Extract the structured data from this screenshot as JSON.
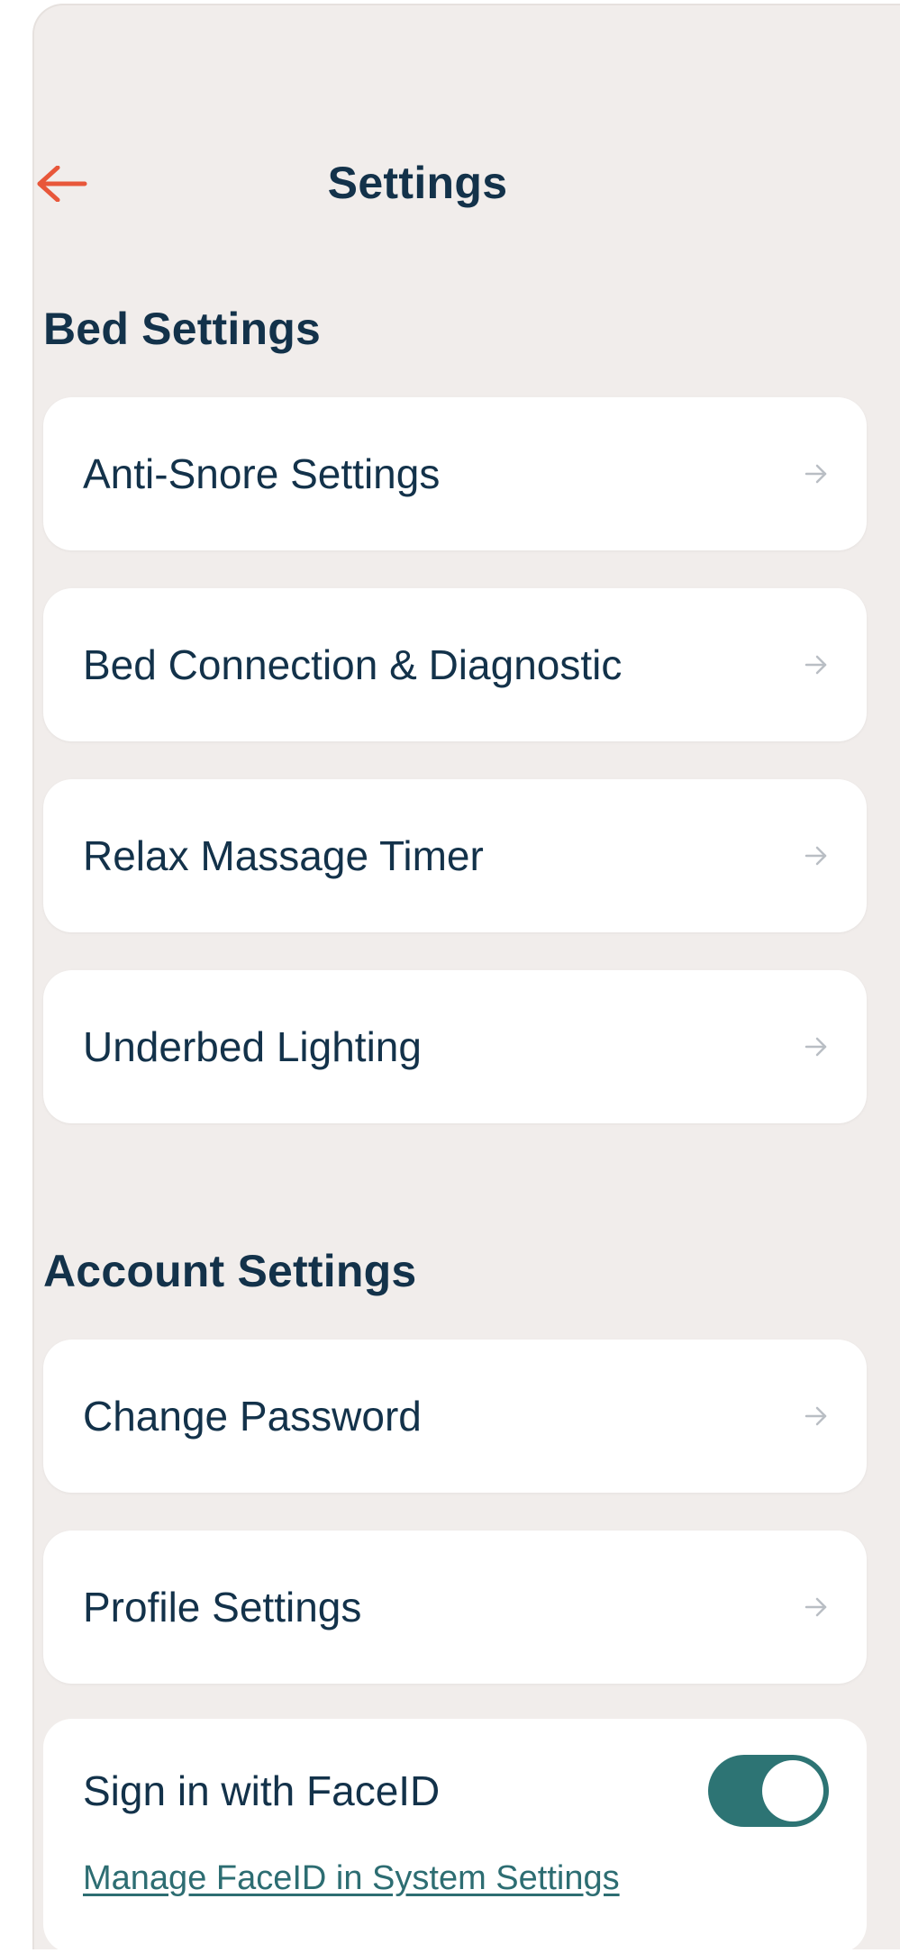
{
  "header": {
    "title": "Settings",
    "back_icon": "arrow-left-icon"
  },
  "colors": {
    "accent": "#e8573a",
    "text": "#13324a",
    "toggle_on": "#2d7474",
    "link": "#2d6d72",
    "background": "#f1edeb"
  },
  "bed_settings": {
    "title": "Bed Settings",
    "items": [
      {
        "label": "Anti-Snore Settings"
      },
      {
        "label": "Bed Connection & Diagnostic"
      },
      {
        "label": "Relax Massage Timer"
      },
      {
        "label": "Underbed Lighting"
      }
    ]
  },
  "account_settings": {
    "title": "Account Settings",
    "items": [
      {
        "label": "Change Password"
      },
      {
        "label": "Profile Settings"
      }
    ],
    "faceid": {
      "label": "Sign in with FaceID",
      "enabled": true,
      "manage_link": "Manage FaceID in System Settings"
    }
  }
}
